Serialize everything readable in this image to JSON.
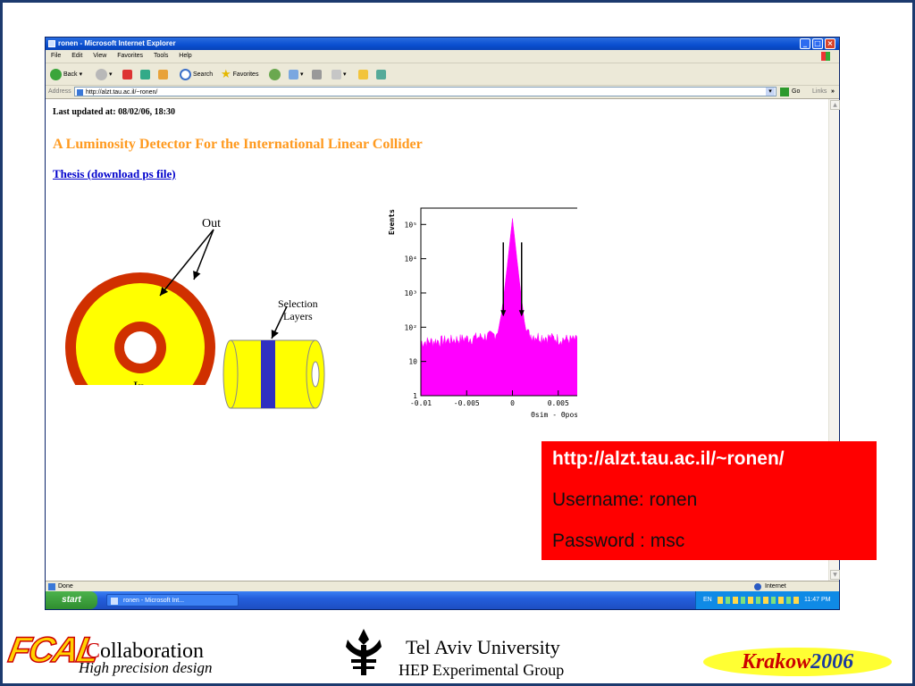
{
  "window": {
    "title": "ronen - Microsoft Internet Explorer",
    "menu": [
      "File",
      "Edit",
      "View",
      "Favorites",
      "Tools",
      "Help"
    ],
    "toolbar": {
      "back": "Back",
      "search": "Search",
      "favorites": "Favorites"
    },
    "address": {
      "label": "Address",
      "url": "http://alzt.tau.ac.il/~ronen/",
      "go": "Go",
      "links": "Links"
    },
    "status": {
      "left": "Done",
      "zone": "Internet"
    }
  },
  "taskbar": {
    "start": "start",
    "item": "ronen - Microsoft Int...",
    "lang": "EN",
    "clock": "11:47 PM"
  },
  "page": {
    "updated": "Last updated at: 08/02/06, 18:30",
    "title": "A Luminosity Detector For the International Linear Collider",
    "thesis_link": "Thesis (download ps file)",
    "diagram": {
      "out": "Out",
      "in": "In",
      "selection": "Selection",
      "layers": "Layers"
    }
  },
  "chart_data": {
    "type": "area",
    "ylabel": "Events",
    "xlabel": "Θsim - Θpos (rad)",
    "x_ticks": [
      "-0.01",
      "-0.005",
      "0",
      "0.005",
      "0.01"
    ],
    "y_ticks": [
      "1",
      "10",
      "10²",
      "10³",
      "10⁴",
      "10⁵"
    ],
    "y_scale": "log",
    "xlim": [
      -0.01,
      0.01
    ],
    "ylim": [
      1,
      300000
    ],
    "peak": {
      "x": 0,
      "y": 150000
    },
    "arrows_x": [
      -0.001,
      0.001
    ],
    "color": "#ff00ff"
  },
  "overlay": {
    "url": "http://alzt.tau.ac.il/~ronen/",
    "username": "Username: ronen",
    "password": "Password : msc"
  },
  "footer": {
    "logo": "FCAL",
    "collab_first": "C",
    "collab_rest": "ollaboration",
    "tagline": "High precision design",
    "univ": "Tel Aviv University",
    "group": "HEP Experimental Group",
    "event": "Krakow",
    "year": "2006"
  }
}
